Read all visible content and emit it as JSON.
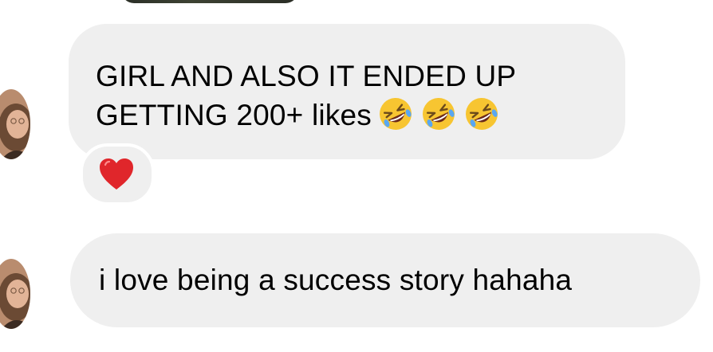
{
  "conversation": {
    "messages": [
      {
        "sender": "contact",
        "text_line1": "GIRL AND ALSO IT ENDED UP",
        "text_line2": "GETTING 200+ likes",
        "emojis": [
          "rolling-on-floor-laughing",
          "rolling-on-floor-laughing",
          "rolling-on-floor-laughing"
        ],
        "reaction": "red-heart"
      },
      {
        "sender": "contact",
        "text": "i love being a success story hahaha"
      }
    ]
  },
  "colors": {
    "bubble_background": "#efefef",
    "text": "#000000",
    "heart": "#e0262b",
    "emoji_face": "#f7c531"
  }
}
